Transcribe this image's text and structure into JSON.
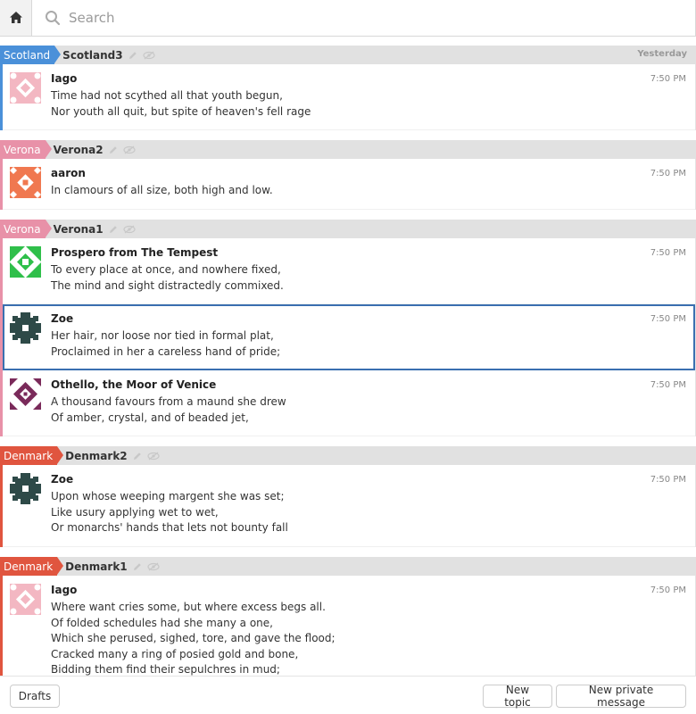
{
  "search": {
    "placeholder": "Search"
  },
  "colors": {
    "scotland": "#4a90d9",
    "verona": "#e891a8",
    "denmark": "#e0553f"
  },
  "groups": [
    {
      "stream": "Scotland",
      "topic": "Scotland3",
      "date": "Yesterday",
      "color": "#4a90d9",
      "messages": [
        {
          "sender": "Iago",
          "time": "7:50 PM",
          "avatar": "iago",
          "lines": [
            "Time had not scythed all that youth begun,",
            "Nor youth all quit, but spite of heaven's fell rage"
          ]
        }
      ]
    },
    {
      "stream": "Verona",
      "topic": "Verona2",
      "date": "",
      "color": "#e891a8",
      "messages": [
        {
          "sender": "aaron",
          "time": "7:50 PM",
          "avatar": "aaron",
          "lines": [
            "In clamours of all size, both high and low."
          ]
        }
      ]
    },
    {
      "stream": "Verona",
      "topic": "Verona1",
      "date": "",
      "color": "#e891a8",
      "messages": [
        {
          "sender": "Prospero from The Tempest",
          "time": "7:50 PM",
          "avatar": "prospero",
          "lines": [
            "To every place at once, and nowhere fixed,",
            "The mind and sight distractedly commixed."
          ]
        },
        {
          "sender": "Zoe",
          "time": "7:50 PM",
          "avatar": "zoe",
          "selected": true,
          "lines": [
            "Her hair, nor loose nor tied in formal plat,",
            "Proclaimed in her a careless hand of pride;"
          ]
        },
        {
          "sender": "Othello, the Moor of Venice",
          "time": "7:50 PM",
          "avatar": "othello",
          "lines": [
            "A thousand favours from a maund she drew",
            "Of amber, crystal, and of beaded jet,"
          ]
        }
      ]
    },
    {
      "stream": "Denmark",
      "topic": "Denmark2",
      "date": "",
      "color": "#e0553f",
      "messages": [
        {
          "sender": "Zoe",
          "time": "7:50 PM",
          "avatar": "zoe",
          "lines": [
            "Upon whose weeping margent she was set;",
            "Like usury applying wet to wet,",
            "Or monarchs' hands that lets not bounty fall"
          ]
        }
      ]
    },
    {
      "stream": "Denmark",
      "topic": "Denmark1",
      "date": "",
      "color": "#e0553f",
      "messages": [
        {
          "sender": "Iago",
          "time": "7:50 PM",
          "avatar": "iago",
          "lines": [
            "Where want cries some, but where excess begs all.",
            "Of folded schedules had she many a one,",
            "Which she perused, sighed, tore, and gave the flood;",
            "Cracked many a ring of posied gold and bone,",
            "Bidding them find their sepulchres in mud;"
          ]
        }
      ]
    }
  ],
  "footer": {
    "drafts_label": "Drafts",
    "new_topic_label": "New topic",
    "new_pm_label": "New private message"
  }
}
